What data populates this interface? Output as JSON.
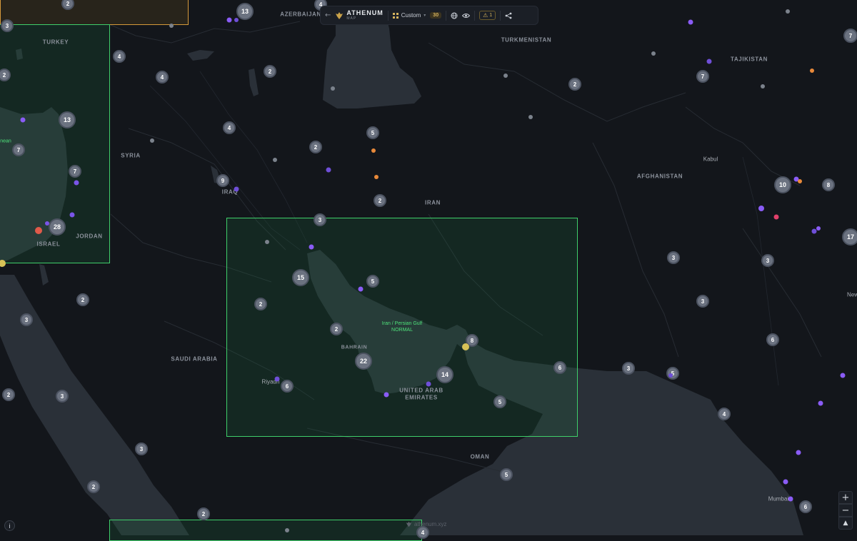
{
  "app": {
    "name": "ATHENUM",
    "subtitle": "MAP",
    "view_mode": "Custom",
    "count_badge": "30",
    "alert_count": "1",
    "watermark": "athenum.xyz"
  },
  "map": {
    "country_labels": [
      "AZERBAIJAN",
      "TURKEY",
      "TURKMENISTAN",
      "TAJIKISTAN",
      "SYRIA",
      "IRAQ",
      "IRAN",
      "AFGHANISTAN",
      "JORDAN",
      "ISRAEL",
      "SAUDI ARABIA",
      "BAHRAIN",
      "UNITED ARAB",
      "EMIRATES",
      "OMAN"
    ],
    "city_labels": [
      "Kabul",
      "Riyadh",
      "Mumbai",
      "nean",
      "New"
    ],
    "zone_labels": [
      "Iran / Persian Gulf",
      "NORMAL"
    ],
    "clusters": [
      "2",
      "3",
      "13",
      "4",
      "2",
      "4",
      "2",
      "13",
      "4",
      "7",
      "7",
      "9",
      "28",
      "2",
      "2",
      "3",
      "3",
      "15",
      "5",
      "2",
      "2",
      "22",
      "8",
      "14",
      "6",
      "5",
      "3",
      "5",
      "2",
      "5",
      "3",
      "2",
      "2",
      "4",
      "7",
      "2",
      "10",
      "8",
      "17",
      "3",
      "3",
      "3",
      "6",
      "4",
      "6",
      "2",
      "3"
    ]
  },
  "colors": {
    "zone_green": "#3fcf6a",
    "zone_amber": "#d5993a",
    "dot_purple": "#8a5cf6",
    "dot_orange": "#e8893a",
    "dot_red": "#e05a4a",
    "dot_yellow": "#d8c257",
    "dot_gray": "#7b828c",
    "dot_pink": "#e0406a"
  },
  "icons": {
    "back": "arrow-left-icon",
    "logo": "eagle-logo",
    "view": "grid-icon",
    "globe": "globe-icon",
    "eye": "eye-icon",
    "alert": "warning-icon",
    "share": "share-icon",
    "info": "info-icon",
    "zoom_in": "plus-icon",
    "zoom_out": "minus-icon",
    "compass": "compass-icon"
  }
}
